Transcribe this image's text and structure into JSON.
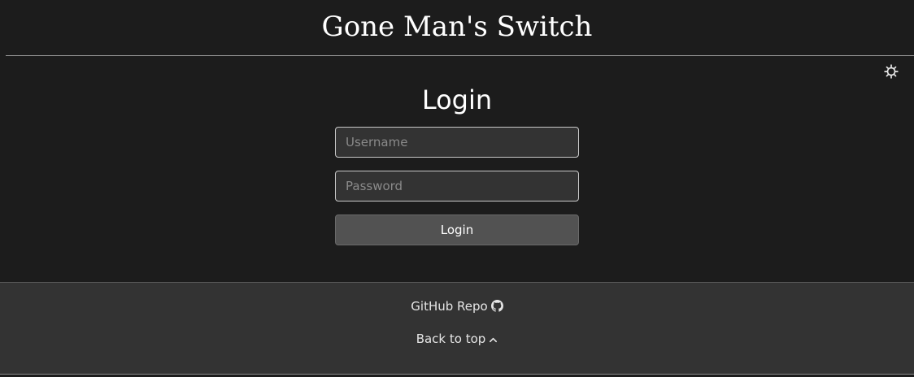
{
  "header": {
    "title": "Gone Man's Switch"
  },
  "theme_toggle": {
    "icon": "gear-icon"
  },
  "login": {
    "heading": "Login",
    "username_placeholder": "Username",
    "password_placeholder": "Password",
    "username_value": "",
    "password_value": "",
    "button_label": "Login"
  },
  "footer": {
    "github_label": "GitHub Repo",
    "github_icon": "github-icon",
    "back_to_top_label": "Back to top",
    "back_to_top_icon": "chevron-up-icon"
  },
  "colors": {
    "background": "#1c1c1c",
    "footer_background": "#333333",
    "input_background": "#333333",
    "button_background": "#525252",
    "text": "#ffffff"
  }
}
